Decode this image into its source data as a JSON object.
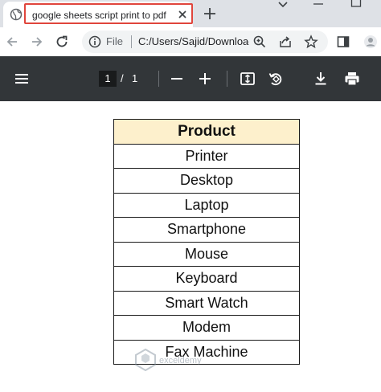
{
  "browser": {
    "tab": {
      "title": "google sheets script print to pdf",
      "favicon": "globe-icon",
      "close_icon": "close-icon"
    },
    "new_tab_icon": "plus-icon",
    "address_bar": {
      "scheme_label": "File",
      "url": "C:/Users/Sajid/Downloads/google sheets script print to pdf.pdf"
    }
  },
  "pdf_viewer": {
    "current_page": "1",
    "separator": "/",
    "total_pages": "1"
  },
  "document": {
    "table": {
      "header": "Product",
      "rows": [
        "Printer",
        "Desktop",
        "Laptop",
        "Smartphone",
        "Mouse",
        "Keyboard",
        "Smart Watch",
        "Modem",
        "Fax Machine"
      ]
    }
  },
  "watermark": {
    "text": "exceldemy"
  },
  "colors": {
    "pdf_toolbar": "#323639",
    "tab_highlight": "#e0453c",
    "table_header_bg": "#fdf0cc"
  }
}
